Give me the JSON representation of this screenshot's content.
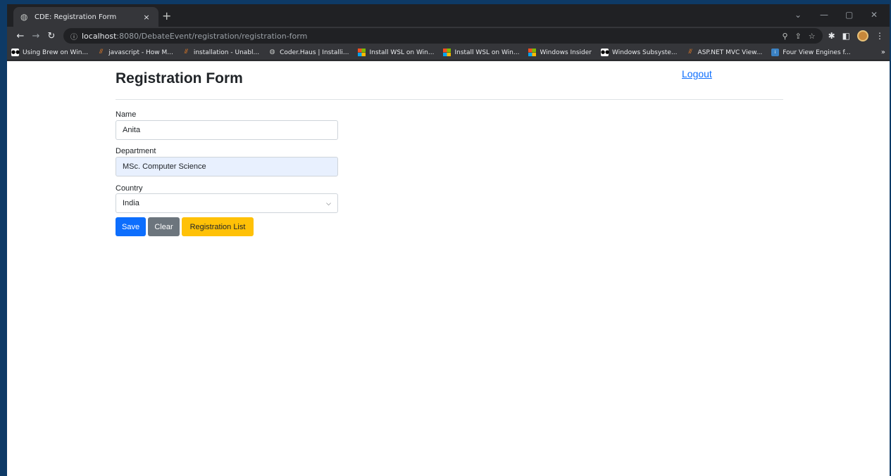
{
  "browser": {
    "tab_title": "CDE: Registration Form",
    "tab_close": "×",
    "new_tab": "+",
    "url_host": "localhost",
    "url_rest": ":8080/DebateEvent/registration/registration-form",
    "bookmarks": [
      {
        "label": "Using Brew on Win...",
        "icon": "medium-icon"
      },
      {
        "label": "javascript - How M...",
        "icon": "stackoverflow-icon"
      },
      {
        "label": "installation - Unabl...",
        "icon": "stackoverflow-icon"
      },
      {
        "label": "Coder.Haus | Installi...",
        "icon": "globe-icon"
      },
      {
        "label": "Install WSL on Win...",
        "icon": "microsoft-icon"
      },
      {
        "label": "Install WSL on Win...",
        "icon": "microsoft-icon"
      },
      {
        "label": "Windows Insider",
        "icon": "microsoft-icon"
      },
      {
        "label": "Windows Subsyste...",
        "icon": "medium-icon"
      },
      {
        "label": "ASP.NET MVC View...",
        "icon": "stackoverflow-icon"
      },
      {
        "label": "Four View Engines f...",
        "icon": "info-icon"
      }
    ],
    "bookmarks_more": "»"
  },
  "page": {
    "title": "Registration Form",
    "logout": "Logout",
    "form": {
      "name_label": "Name",
      "name_value": "Anita",
      "department_label": "Department",
      "department_value": "MSc. Computer Science",
      "country_label": "Country",
      "country_value": "India"
    },
    "buttons": {
      "save": "Save",
      "clear": "Clear",
      "list": "Registration List"
    }
  },
  "colors": {
    "primary": "#0d6efd",
    "secondary": "#6c757d",
    "warning": "#ffc107",
    "autofill": "#e8f0fe"
  }
}
